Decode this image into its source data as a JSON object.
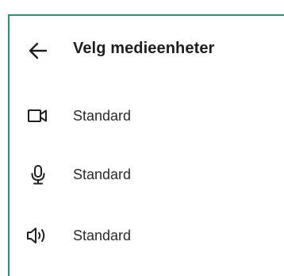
{
  "header": {
    "title": "Velg medieenheter",
    "back_icon": "arrow-left-icon"
  },
  "devices": [
    {
      "icon": "camera-icon",
      "label": "Standard"
    },
    {
      "icon": "microphone-icon",
      "label": "Standard"
    },
    {
      "icon": "speaker-icon",
      "label": "Standard"
    }
  ],
  "colors": {
    "accent_border": "#1c9a76",
    "text": "#1f1f1f"
  }
}
